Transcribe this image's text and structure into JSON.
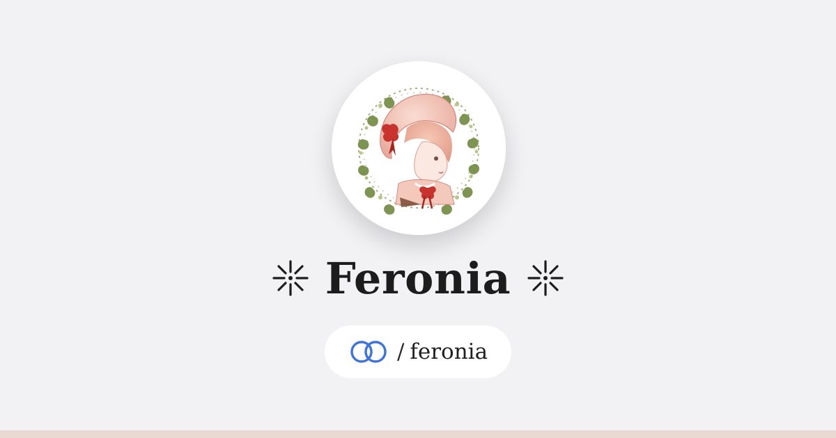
{
  "profile": {
    "name": "Feronia",
    "handle_slash": "/",
    "handle": "feronia",
    "avatar_alt": "Illustration avatar in vine wreath"
  },
  "icons": {
    "decor_left": "asterisk-star-icon",
    "decor_right": "asterisk-star-icon",
    "brand": "linked-rings-icon"
  },
  "colors": {
    "background": "#f2f2f4",
    "text": "#1c1c1c",
    "brand_blue": "#3b73e0",
    "footer_stripe": "#ead8d3"
  }
}
